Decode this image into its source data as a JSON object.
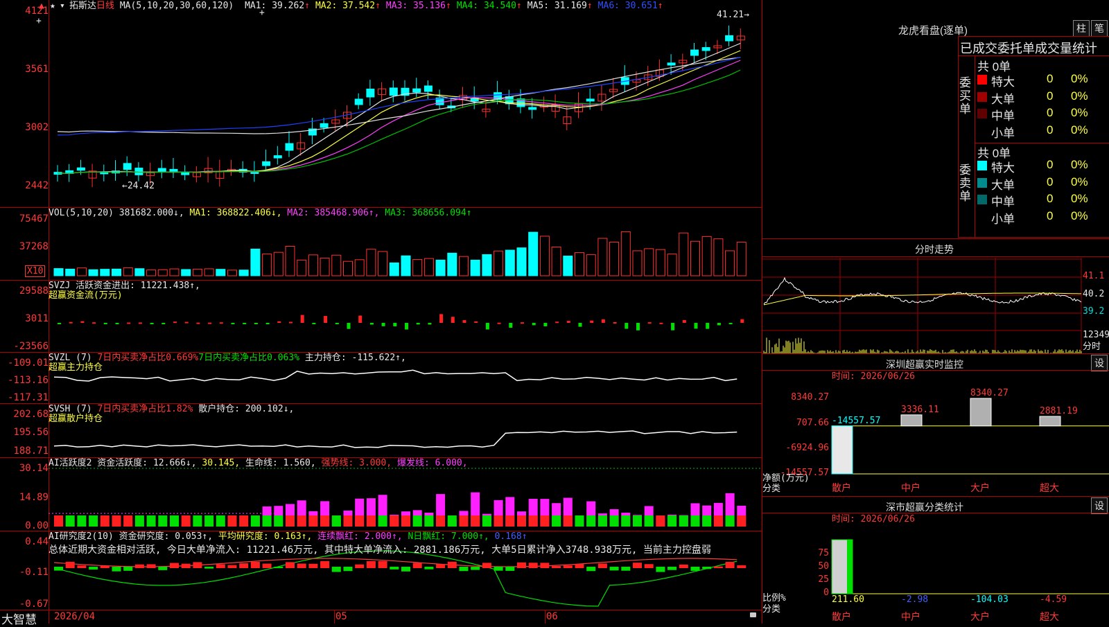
{
  "stock": {
    "name": "拓斯达",
    "period": "日线",
    "ma_label": "MA(5,10,20,30,60,120)",
    "ma": [
      {
        "label": "MA1:",
        "value": "39.262",
        "arrow": "↑",
        "color": "#e8e8e8"
      },
      {
        "label": "MA2:",
        "value": "37.542",
        "arrow": "↑",
        "color": "#ffff40"
      },
      {
        "label": "MA3:",
        "value": "35.136",
        "arrow": "↑",
        "color": "#ff40ff"
      },
      {
        "label": "MA4:",
        "value": "34.540",
        "arrow": "↑",
        "color": "#00e000"
      },
      {
        "label": "MA5:",
        "value": "31.169",
        "arrow": "↑",
        "color": "#e8e8e8"
      },
      {
        "label": "MA6:",
        "value": "30.651",
        "arrow": "↑",
        "color": "#3050ff"
      }
    ],
    "high_mark": "41.21",
    "low_mark": "24.42",
    "price_axis": [
      "4121",
      "3561",
      "3002",
      "2442"
    ]
  },
  "vol": {
    "label": "VOL(5,10,20)",
    "value": "381682.000↓,",
    "ma1": "MA1: 368822.406↓,",
    "ma2": "MA2: 385468.906↑,",
    "ma3": "MA3: 368656.094↑",
    "axis": [
      "75467",
      "37268"
    ],
    "unit": "X10"
  },
  "svzj": {
    "label": "SVZJ  活跃资金进出: 11221.438↑,",
    "sub": "超赢资金流(万元)",
    "axis": [
      "29588",
      "3011",
      "-23566"
    ]
  },
  "svzl": {
    "label": "SVZL (7)",
    "t1": "7日内买卖净占比0.669%",
    "t2": "7日内买卖净占比0.063%",
    "t3": "主力持仓: -115.622↑,",
    "sub": "超赢主力持仓",
    "axis": [
      "-109.01",
      "-113.16",
      "-117.31"
    ]
  },
  "svsh": {
    "label": "SVSH (7)",
    "t1": "7日内买卖净占比1.82%",
    "t2": "散户持仓: 200.102↓,",
    "sub": "超赢散户持仓",
    "axis": [
      "202.68",
      "195.56",
      "188.71"
    ]
  },
  "ai1": {
    "label": "AI活跃度2 资金活跃度: 12.666↓,",
    "v2": "30.145,",
    "v3": "生命线: 1.560,",
    "v4": "强势线: 3.000,",
    "v5": "爆发线: 6.000,",
    "axis": [
      "30.14",
      "14.89",
      "0.00"
    ]
  },
  "ai2": {
    "label": "AI研究度2(10) 资金研究度: 0.053↑,",
    "v2": "平均研究度: 0.163↑,",
    "v3": "连续飘红: 2.000↑,",
    "v4": "N日飘红: 7.000↑,",
    "v5": "0.168↑",
    "summary": "总体近期大资金相对活跃, 今日大单净流入: 11221.46万元, 其中特大单净流入: 2881.186万元, 大单5日累计净入3748.938万元, 当前主力控盘弱",
    "axis": [
      "0.44",
      "-0.11",
      "-0.67"
    ]
  },
  "bottom": {
    "brand": "大智慧",
    "date": "2026/04",
    "m05": "05",
    "m06": "06"
  },
  "dragon": {
    "title": "龙虎看盘(逐单)",
    "btn1": "柱",
    "btn2": "笔",
    "header": "已成交委托单成交量统计",
    "buy_side": "委买单",
    "sell_side": "委卖单",
    "buy_total": "共 0单",
    "sell_total": "共 0单",
    "buy_rows": [
      {
        "label": "特大",
        "count": "0",
        "pct": "0%",
        "color": "#ff0000"
      },
      {
        "label": "大单",
        "count": "0",
        "pct": "0%",
        "color": "#a00000"
      },
      {
        "label": "中单",
        "count": "0",
        "pct": "0%",
        "color": "#600000"
      },
      {
        "label": "小单",
        "count": "0",
        "pct": "0%",
        "color": "#000000"
      }
    ],
    "sell_rows": [
      {
        "label": "特大",
        "count": "0",
        "pct": "0%",
        "color": "#00ffff"
      },
      {
        "label": "大单",
        "count": "0",
        "pct": "0%",
        "color": "#008c8c"
      },
      {
        "label": "中单",
        "count": "0",
        "pct": "0%",
        "color": "#006a6a"
      },
      {
        "label": "小单",
        "count": "0",
        "pct": "0%",
        "color": "#000000"
      }
    ]
  },
  "intraday": {
    "title": "分时走势",
    "axis": [
      "41.1",
      "40.2",
      "39.2",
      "12349"
    ],
    "unit": "分时"
  },
  "monitor": {
    "title": "深圳超赢实时监控",
    "btn": "设",
    "time": "时间: 2026/06/26",
    "axis": [
      "8340.27",
      "707.66",
      "-6924.96",
      "-14557.57"
    ],
    "ylabel1": "净额(万元)",
    "ylabel2": "分类",
    "values": [
      "-14557.57",
      "3336.11",
      "8340.27",
      "2881.19"
    ],
    "cats": [
      "散户",
      "中户",
      "大户",
      "超大"
    ]
  },
  "classify": {
    "title": "深市超赢分类统计",
    "btn": "设",
    "time": "时间: 2026/06/26",
    "axis": [
      "75",
      "50",
      "25",
      "0"
    ],
    "ylabel1": "比例%",
    "ylabel2": "分类",
    "values": [
      "211.60",
      "-2.98",
      "-104.03",
      "-4.59"
    ],
    "cats": [
      "散户",
      "中户",
      "大户",
      "超大"
    ]
  }
}
